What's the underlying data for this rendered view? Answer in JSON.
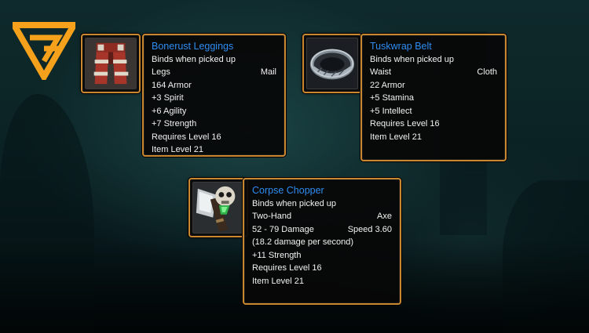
{
  "items": [
    {
      "name": "Bonerust Leggings",
      "icon": "leggings-icon",
      "binding": "Binds when picked up",
      "slot": "Legs",
      "type": "Mail",
      "lines": [
        "164 Armor",
        "+3 Spirit",
        "+6 Agility",
        "+7 Strength",
        "Requires Level 16",
        "Item Level 21"
      ]
    },
    {
      "name": "Tuskwrap Belt",
      "icon": "belt-icon",
      "binding": "Binds when picked up",
      "slot": "Waist",
      "type": "Cloth",
      "lines": [
        "22 Armor",
        "+5 Stamina",
        "+5 Intellect",
        "Requires Level 16",
        "Item Level 21"
      ]
    },
    {
      "name": "Corpse Chopper",
      "icon": "skull-axe-icon",
      "binding": "Binds when picked up",
      "slot": "Two-Hand",
      "type": "Axe",
      "damage": "52 - 79 Damage",
      "speed": "Speed 3.60",
      "lines": [
        "(18.2 damage per second)",
        "+11 Strength",
        "Requires Level 16",
        "Item Level 21"
      ]
    }
  ],
  "colors": {
    "item_name": "#2e8cf0",
    "border": "#c9882f",
    "text": "#f2f2f2"
  }
}
